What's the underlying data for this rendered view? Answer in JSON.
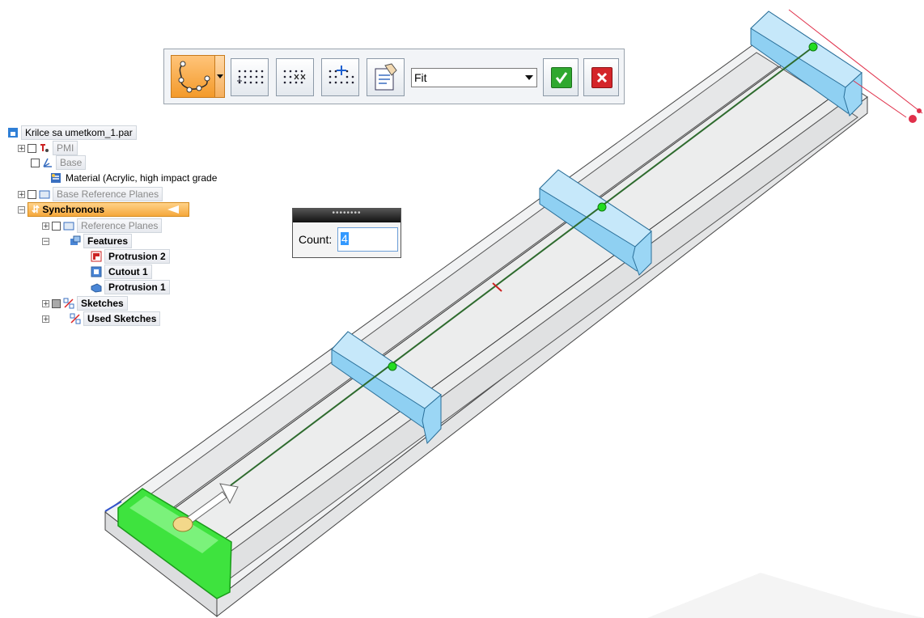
{
  "toolbar": {
    "path_tool": "path-pattern-icon",
    "fill_options": [
      "Fit"
    ],
    "fill_selected": "Fit",
    "buttons": [
      "fill-pattern-icon",
      "suppress-occurrence-icon",
      "add-occurrence-icon",
      "pattern-options-icon",
      "accept-check-icon",
      "cancel-x-icon"
    ]
  },
  "tree": {
    "root": "Krilce sa umetkom_1.par",
    "pmi": "PMI",
    "base": "Base",
    "material": "Material (Acrylic, high impact grade",
    "base_ref_planes": "Base Reference Planes",
    "synchronous": "Synchronous",
    "ref_planes": "Reference Planes",
    "features": "Features",
    "protrusion2": "Protrusion 2",
    "cutout1": "Cutout 1",
    "protrusion1": "Protrusion 1",
    "sketches": "Sketches",
    "used_sketches": "Used Sketches"
  },
  "count_dialog": {
    "grip": "••••••••",
    "label": "Count:",
    "value": "4"
  },
  "colors": {
    "highlight_orange": "#f5a83c",
    "feature_blue": "#8fd0f2",
    "selection_green": "#33dd33",
    "path_line": "#2e6b2e",
    "part_gray": "#e8eaec"
  }
}
